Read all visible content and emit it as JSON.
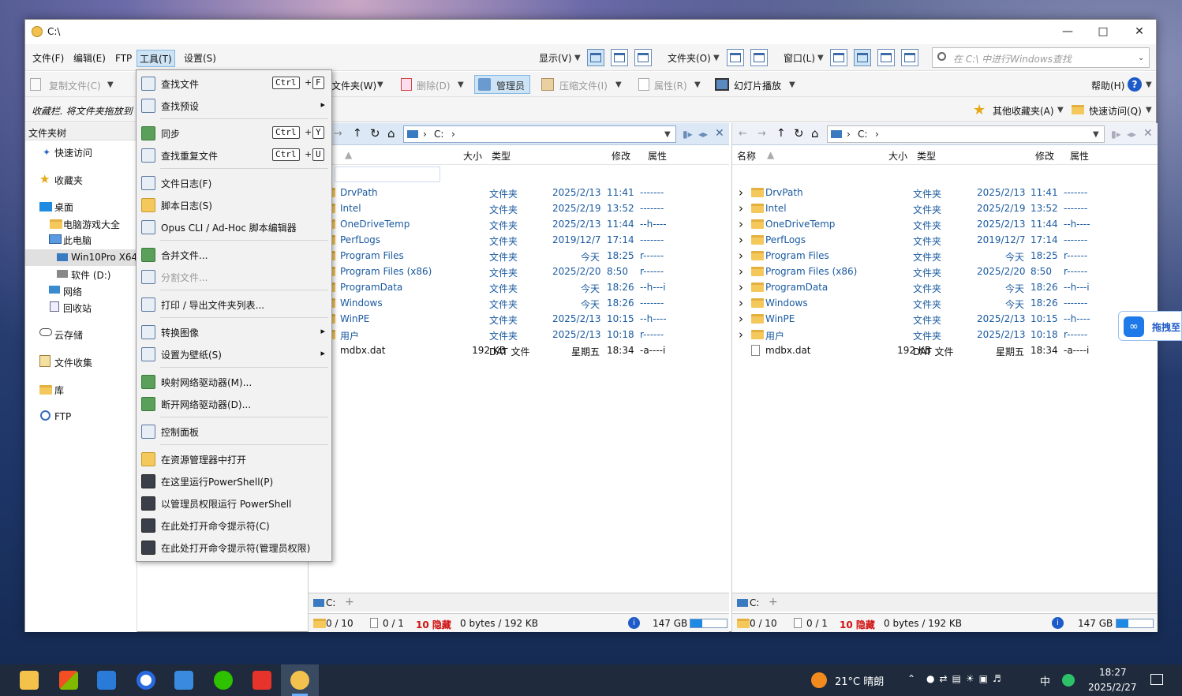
{
  "window": {
    "title": "C:\\"
  },
  "menubar": {
    "items": [
      "文件(F)",
      "编辑(E)",
      "FTP",
      "工具(T)",
      "设置(S)"
    ],
    "right": [
      "显示(V)",
      "文件夹(O)",
      "窗口(L)"
    ]
  },
  "search": {
    "placeholder": "在 C:\\ 中进行Windows查找"
  },
  "toolbar2": {
    "copy": "复制文件(C)",
    "folder": "文件夹(W)",
    "delete": "删除(D)",
    "admin": "管理员",
    "compress": "压缩文件(I)",
    "props": "属性(R)",
    "slideshow": "幻灯片播放",
    "help": "帮助(H)"
  },
  "toolbar3": {
    "favbar": "收藏栏. 将文件夹拖放到",
    "other_fav": "其他收藏夹(A)",
    "quick": "快速访问(Q)"
  },
  "tree": {
    "header": "文件夹树",
    "items": [
      "快速访问",
      "收藏夹",
      "桌面",
      "电脑游戏大全",
      "此电脑",
      "Win10Pro X64",
      "软件 (D:)",
      "网络",
      "回收站",
      "云存储",
      "文件收集",
      "库",
      "FTP"
    ]
  },
  "panes": {
    "path": "C:",
    "columns": {
      "name": "名称",
      "size": "大小",
      "type": "类型",
      "modified": "修改",
      "attr": "属性"
    },
    "rows": [
      {
        "name": "DrvPath",
        "size": "",
        "type": "文件夹",
        "date": "2025/2/13",
        "time": "11:41",
        "attr": "-------"
      },
      {
        "name": "Intel",
        "size": "",
        "type": "文件夹",
        "date": "2025/2/19",
        "time": "13:52",
        "attr": "-------"
      },
      {
        "name": "OneDriveTemp",
        "size": "",
        "type": "文件夹",
        "date": "2025/2/13",
        "time": "11:44",
        "attr": "--h----"
      },
      {
        "name": "PerfLogs",
        "size": "",
        "type": "文件夹",
        "date": "2019/12/7",
        "time": "17:14",
        "attr": "-------"
      },
      {
        "name": "Program Files",
        "size": "",
        "type": "文件夹",
        "date": "今天",
        "time": "18:25",
        "attr": "r------"
      },
      {
        "name": "Program Files (x86)",
        "size": "",
        "type": "文件夹",
        "date": "2025/2/20",
        "time": "8:50",
        "attr": "r------"
      },
      {
        "name": "ProgramData",
        "size": "",
        "type": "文件夹",
        "date": "今天",
        "time": "18:26",
        "attr": "--h---i"
      },
      {
        "name": "Windows",
        "size": "",
        "type": "文件夹",
        "date": "今天",
        "time": "18:26",
        "attr": "-------"
      },
      {
        "name": "WinPE",
        "size": "",
        "type": "文件夹",
        "date": "2025/2/13",
        "time": "10:15",
        "attr": "--h----"
      },
      {
        "name": "用户",
        "size": "",
        "type": "文件夹",
        "date": "2025/2/13",
        "time": "10:18",
        "attr": "r------"
      },
      {
        "name": "mdbx.dat",
        "size": "192 KB",
        "type": "DAT 文件",
        "date": "星期五",
        "time": "18:34",
        "attr": "-a----i"
      }
    ],
    "tab": "C:",
    "status": {
      "folders": "0 / 10",
      "files": "0 / 1",
      "hidden": "10 隐藏",
      "bytes": "0 bytes / 192 KB",
      "free": "147 GB"
    },
    "free_fraction": 0.32
  },
  "context_menu": {
    "items": [
      {
        "label": "查找文件",
        "key": "F"
      },
      {
        "label": "查找预设",
        "submenu": true
      },
      {
        "label": "同步",
        "key": "Y"
      },
      {
        "label": "查找重复文件",
        "key": "U"
      },
      {
        "label": "文件日志(F)"
      },
      {
        "label": "脚本日志(S)"
      },
      {
        "label": "Opus CLI / Ad-Hoc 脚本编辑器"
      },
      {
        "label": "合并文件..."
      },
      {
        "label": "分割文件...",
        "disabled": true
      },
      {
        "label": "打印 / 导出文件夹列表..."
      },
      {
        "label": "转换图像",
        "submenu": true
      },
      {
        "label": "设置为壁纸(S)",
        "submenu": true
      },
      {
        "label": "映射网络驱动器(M)..."
      },
      {
        "label": "断开网络驱动器(D)..."
      },
      {
        "label": "控制面板"
      },
      {
        "label": "在资源管理器中打开"
      },
      {
        "label": "在这里运行PowerShell(P)"
      },
      {
        "label": "以管理员权限运行 PowerShell"
      },
      {
        "label": "在此处打开命令提示符(C)"
      },
      {
        "label": "在此处打开命令提示符(管理员权限)"
      }
    ],
    "ctrl": "Ctrl",
    "plus": "+"
  },
  "side_float": {
    "label": "拖拽至"
  },
  "taskbar": {
    "weather": "21°C 晴朗",
    "time": "18:27",
    "date": "2025/2/27",
    "ime": "中"
  }
}
